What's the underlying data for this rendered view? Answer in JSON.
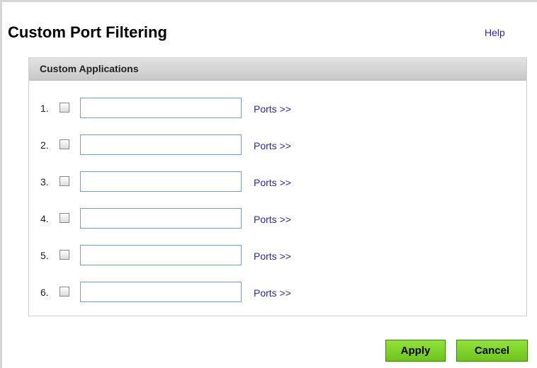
{
  "page": {
    "title": "Custom Port Filtering",
    "help_label": "Help"
  },
  "panel": {
    "header": "Custom Applications"
  },
  "rows": [
    {
      "number": "1.",
      "checked": false,
      "value": "",
      "link_label": "Ports >>"
    },
    {
      "number": "2.",
      "checked": false,
      "value": "",
      "link_label": "Ports >>"
    },
    {
      "number": "3.",
      "checked": false,
      "value": "",
      "link_label": "Ports >>"
    },
    {
      "number": "4.",
      "checked": false,
      "value": "",
      "link_label": "Ports >>"
    },
    {
      "number": "5.",
      "checked": false,
      "value": "",
      "link_label": "Ports >>"
    },
    {
      "number": "6.",
      "checked": false,
      "value": "",
      "link_label": "Ports >>"
    }
  ],
  "actions": {
    "apply_label": "Apply",
    "cancel_label": "Cancel"
  },
  "colors": {
    "link": "#2a2aa8",
    "button_green": "#7ed32a",
    "header_gray": "#d0d0d0",
    "input_border": "#7f9db9"
  }
}
